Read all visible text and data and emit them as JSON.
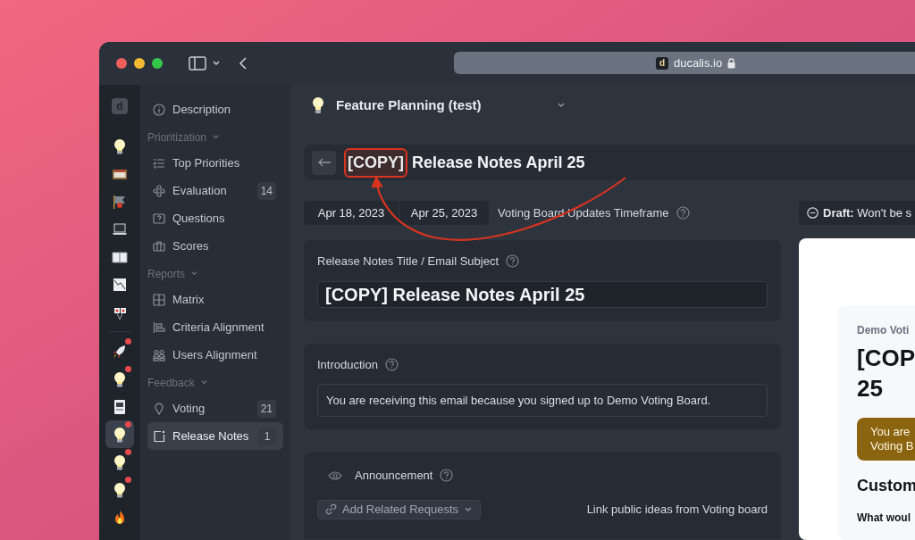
{
  "browser": {
    "url": "ducalis.io",
    "favicon": "d"
  },
  "rail": {
    "logo": "d",
    "items": [
      {
        "dot": false,
        "selected": false
      },
      {
        "dot": false,
        "selected": false
      },
      {
        "dot": false,
        "selected": false
      },
      {
        "dot": false,
        "selected": false
      },
      {
        "dot": false,
        "selected": false
      },
      {
        "dot": false,
        "selected": false
      },
      {
        "dot": false,
        "selected": false
      },
      {
        "dot": true,
        "selected": false
      },
      {
        "dot": true,
        "selected": false
      },
      {
        "dot": false,
        "selected": false
      },
      {
        "dot": true,
        "selected": true
      },
      {
        "dot": true,
        "selected": false
      },
      {
        "dot": true,
        "selected": false
      },
      {
        "dot": false,
        "selected": false
      }
    ]
  },
  "sidebar": {
    "items": [
      {
        "kind": "item",
        "label": "Description",
        "selected": false
      },
      {
        "kind": "section",
        "label": "Prioritization"
      },
      {
        "kind": "item",
        "label": "Top Priorities",
        "selected": false
      },
      {
        "kind": "item",
        "label": "Evaluation",
        "count": "14",
        "selected": false
      },
      {
        "kind": "item",
        "label": "Questions",
        "selected": false
      },
      {
        "kind": "item",
        "label": "Scores",
        "selected": false
      },
      {
        "kind": "section",
        "label": "Reports"
      },
      {
        "kind": "item",
        "label": "Matrix",
        "selected": false
      },
      {
        "kind": "item",
        "label": "Criteria Alignment",
        "selected": false
      },
      {
        "kind": "item",
        "label": "Users Alignment",
        "selected": false
      },
      {
        "kind": "section",
        "label": "Feedback"
      },
      {
        "kind": "item",
        "label": "Voting",
        "count": "21",
        "selected": false
      },
      {
        "kind": "item",
        "label": "Release Notes",
        "count": "1",
        "selected": true
      }
    ]
  },
  "header": {
    "board": "Feature Planning (test)"
  },
  "title": {
    "highlighted": "[COPY]",
    "rest": "Release Notes April 25"
  },
  "timeframe": {
    "start": "Apr 18, 2023",
    "end": "Apr 25, 2023",
    "label": "Voting Board Updates Timeframe"
  },
  "subject": {
    "label": "Release Notes Title / Email Subject",
    "value": "[COPY] Release Notes April 25"
  },
  "introduction": {
    "label": "Introduction",
    "value": "You are receiving this email because you signed up to Demo Voting Board."
  },
  "announcement": {
    "label": "Announcement",
    "button": "Add Related Requests",
    "hint": "Link public ideas from Voting board"
  },
  "status": {
    "text": "**Draft:** Won't be s"
  },
  "preview": {
    "site_name": "Demo Voti",
    "title_lines": [
      "[COP",
      "25"
    ],
    "notice_lines": [
      "You are",
      "Voting B"
    ],
    "heading": "Custom",
    "question": "What woul"
  }
}
